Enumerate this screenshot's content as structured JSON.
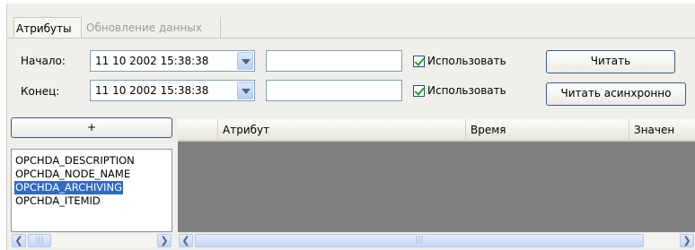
{
  "tabs": [
    {
      "label": "Атрибуты",
      "active": true
    },
    {
      "label": "Обновление данных",
      "active": false
    }
  ],
  "start": {
    "label": "Начало:",
    "datetime": "11 10 2002 15:38:38",
    "text_value": "",
    "use_label": "Использовать",
    "use_checked": true
  },
  "end": {
    "label": "Конец:",
    "datetime": "11 10 2002 15:38:38",
    "text_value": "",
    "use_label": "Использовать",
    "use_checked": true
  },
  "buttons": {
    "read": "Читать",
    "read_async": "Читать асинхронно",
    "add": "+"
  },
  "attribute_list": [
    {
      "label": "OPCHDA_DESCRIPTION",
      "selected": false
    },
    {
      "label": "OPCHDA_NODE_NAME",
      "selected": false
    },
    {
      "label": "OPCHDA_ARCHIVING",
      "selected": true
    },
    {
      "label": "OPCHDA_ITEMID",
      "selected": false
    }
  ],
  "grid": {
    "columns": [
      "",
      "Атрибут",
      "Время",
      "Значен"
    ]
  },
  "icons": {
    "dropdown": "chevron-down-icon",
    "scroll_left": "arrow-left-icon",
    "scroll_right": "arrow-right-icon",
    "check": "check-icon"
  },
  "colors": {
    "selection": "#316ac5",
    "grid_background": "#808080",
    "accent_border": "#3c5a8c"
  }
}
